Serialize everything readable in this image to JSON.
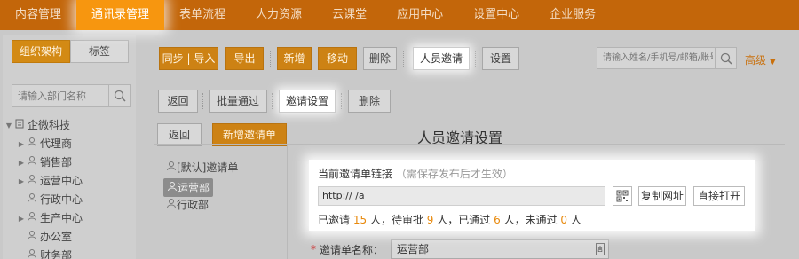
{
  "topnav": {
    "items": [
      "内容管理",
      "通讯录管理",
      "表单流程",
      "人力资源",
      "云课堂",
      "应用中心",
      "设置中心",
      "企业服务"
    ]
  },
  "sidebar": {
    "tab_org": "组织架构",
    "tab_tag": "标签",
    "search_placeholder": "请输入部门名称",
    "tree": [
      {
        "label": "企微科技"
      },
      {
        "label": "代理商"
      },
      {
        "label": "销售部"
      },
      {
        "label": "运营中心"
      },
      {
        "label": "行政中心"
      },
      {
        "label": "生产中心"
      },
      {
        "label": "办公室"
      },
      {
        "label": "财务部"
      }
    ]
  },
  "toolbar": {
    "sync_import": "同步 | 导入",
    "export": "导出",
    "add": "新增",
    "move": "移动",
    "delete": "删除",
    "invite": "人员邀请",
    "settings": "设置",
    "search_placeholder": "请输入姓名/手机号/邮箱/账号",
    "advanced": "高级"
  },
  "toolbar2": {
    "back": "返回",
    "batch_approve": "批量通过",
    "invite_settings": "邀请设置",
    "delete": "删除"
  },
  "invite": {
    "back": "返回",
    "new_form": "新增邀请单",
    "page_title": "人员邀请设置",
    "forms": [
      "[默认]邀请单",
      "运营部",
      "行政部"
    ],
    "link_title": "当前邀请单链接",
    "link_hint": "（需保存发布后才生效）",
    "link_url": "http://                    /a",
    "copy_url": "复制网址",
    "open_direct": "直接打开",
    "stats": {
      "invited_prefix": "已邀请",
      "invited": "15",
      "pending_prefix": "人，待审批",
      "pending": "9",
      "approved_prefix": "人，已通过",
      "approved": "6",
      "rejected_prefix": "人，未通过",
      "rejected": "0",
      "suffix": "人"
    },
    "form_name_label": "邀请单名称：",
    "form_name_value": "运营部"
  }
}
